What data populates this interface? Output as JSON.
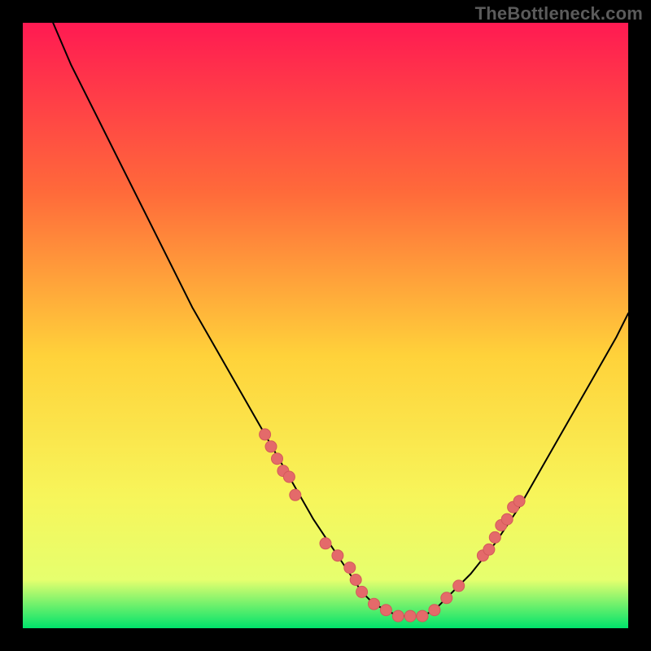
{
  "watermark": "TheBottleneck.com",
  "colors": {
    "background": "#000000",
    "gradient_top": "#ff1a52",
    "gradient_mid_upper": "#ff6a3a",
    "gradient_mid": "#ffd23a",
    "gradient_mid_lower": "#f7f55a",
    "gradient_lower": "#e6ff6e",
    "gradient_bottom": "#00e36b",
    "curve": "#000000",
    "marker_fill": "#e46a6a",
    "marker_stroke": "#d35a5a",
    "watermark": "#5b5b5b"
  },
  "chart_data": {
    "type": "line",
    "title": "",
    "xlabel": "",
    "ylabel": "",
    "xlim": [
      0,
      100
    ],
    "ylim": [
      0,
      100
    ],
    "grid": false,
    "legend": false,
    "series": [
      {
        "name": "bottleneck-curve",
        "x": [
          5,
          8,
          12,
          16,
          20,
          24,
          28,
          32,
          36,
          40,
          44,
          48,
          50,
          52,
          54,
          56,
          58,
          60,
          62,
          64,
          66,
          68,
          70,
          74,
          78,
          82,
          86,
          90,
          94,
          98,
          100
        ],
        "y": [
          100,
          93,
          85,
          77,
          69,
          61,
          53,
          46,
          39,
          32,
          25,
          18,
          15,
          12,
          9,
          6,
          4,
          3,
          2,
          2,
          2,
          3,
          5,
          9,
          14,
          20,
          27,
          34,
          41,
          48,
          52
        ]
      }
    ],
    "markers": [
      {
        "name": "curve-markers",
        "points": [
          [
            40,
            32
          ],
          [
            41,
            30
          ],
          [
            42,
            28
          ],
          [
            43,
            26
          ],
          [
            44,
            25
          ],
          [
            45,
            22
          ],
          [
            50,
            14
          ],
          [
            52,
            12
          ],
          [
            54,
            10
          ],
          [
            55,
            8
          ],
          [
            56,
            6
          ],
          [
            58,
            4
          ],
          [
            60,
            3
          ],
          [
            62,
            2
          ],
          [
            64,
            2
          ],
          [
            66,
            2
          ],
          [
            68,
            3
          ],
          [
            70,
            5
          ],
          [
            72,
            7
          ],
          [
            76,
            12
          ],
          [
            77,
            13
          ],
          [
            78,
            15
          ],
          [
            79,
            17
          ],
          [
            80,
            18
          ],
          [
            81,
            20
          ],
          [
            82,
            21
          ]
        ]
      }
    ]
  }
}
